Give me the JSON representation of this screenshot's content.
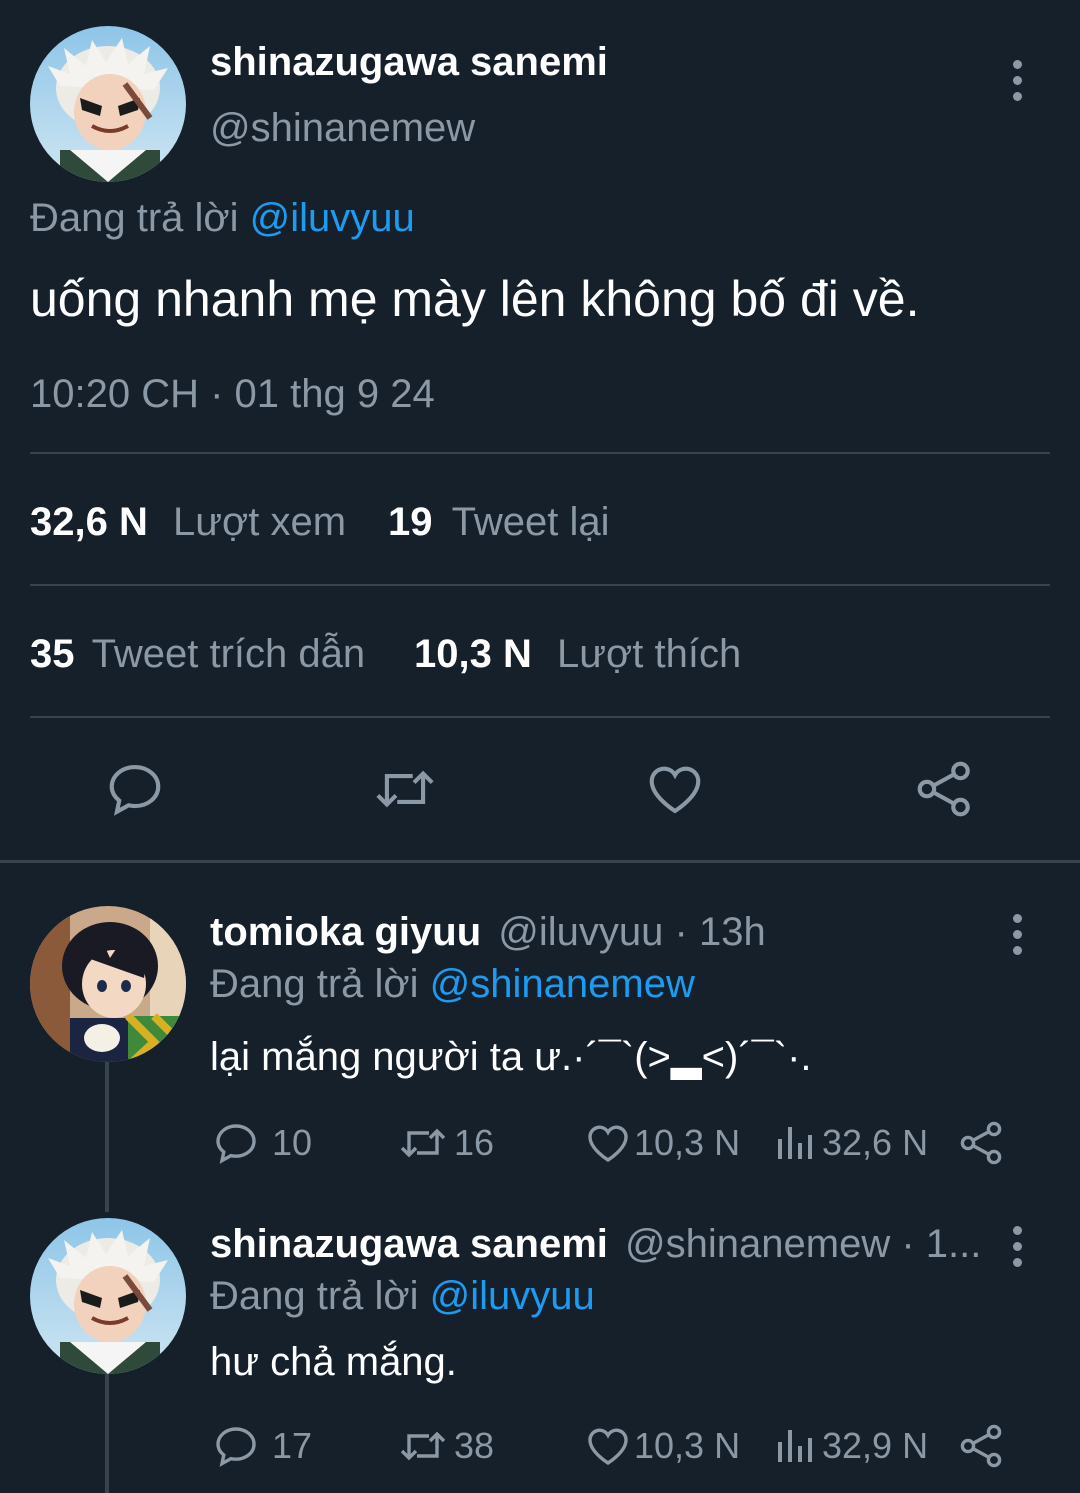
{
  "main_tweet": {
    "display_name": "shinazugawa sanemi",
    "handle": "@shinanemew",
    "replying_prefix": "Đang trả lời",
    "replying_to": "@iluvyuu",
    "text": "uống nhanh mẹ mày lên không bố đi về.",
    "timestamp": "10:20 CH · 01 thg 9 24",
    "stats": {
      "views_value": "32,6 N",
      "views_label": "Lượt xem",
      "retweets_value": "19",
      "retweets_label": "Tweet lại",
      "quotes_value": "35",
      "quotes_label": "Tweet trích dẫn",
      "likes_value": "10,3 N",
      "likes_label": "Lượt thích"
    },
    "actions": [
      "reply-icon",
      "retweet-icon",
      "like-icon",
      "share-icon"
    ]
  },
  "replies": [
    {
      "display_name": "tomioka giyuu",
      "handle": "@iluvyuu",
      "time": "· 13h",
      "replying_prefix": "Đang trả lời",
      "replying_to": "@shinanemew",
      "text": "lại mắng người ta ư.·´¯`(>▂<)´¯`·.",
      "replies_count": "10",
      "retweets_count": "16",
      "likes_count": "10,3 N",
      "views_count": "32,6 N"
    },
    {
      "display_name": "shinazugawa sanemi",
      "handle": "@shinanemew",
      "time": "· 1...",
      "replying_prefix": "Đang trả lời",
      "replying_to": "@iluvyuu",
      "text": "hư chả mắng.",
      "replies_count": "17",
      "retweets_count": "38",
      "likes_count": "10,3 N",
      "views_count": "32,9 N"
    }
  ],
  "colors": {
    "background": "#15202b",
    "muted": "#8b98a5",
    "link": "#1d9bf0",
    "divider": "#38444d"
  }
}
